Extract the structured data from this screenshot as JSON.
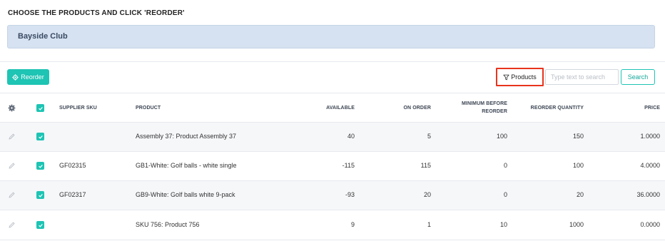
{
  "page": {
    "heading": "CHOOSE THE PRODUCTS AND CLICK 'REORDER'"
  },
  "customer": {
    "name": "Bayside Club"
  },
  "toolbar": {
    "reorder_label": "Reorder",
    "products_filter_label": "Products",
    "search_placeholder": "Type text to search",
    "search_value": "",
    "search_label": "Search"
  },
  "table": {
    "headers": {
      "supplier_sku": "SUPPLIER SKU",
      "product": "PRODUCT",
      "available": "AVAILABLE",
      "on_order": "ON ORDER",
      "minimum_line1": "MINIMUM BEFORE",
      "minimum_line2": "REORDER",
      "reorder_quantity": "REORDER QUANTITY",
      "price": "PRICE"
    },
    "rows": [
      {
        "checked": true,
        "supplier_sku": "",
        "product": "Assembly 37: Product Assembly 37",
        "available": "40",
        "on_order": "5",
        "minimum": "100",
        "reorder_quantity": "150",
        "price": "1.0000"
      },
      {
        "checked": true,
        "supplier_sku": "GF02315",
        "product": "GB1-White: Golf balls - white single",
        "available": "-115",
        "on_order": "115",
        "minimum": "0",
        "reorder_quantity": "100",
        "price": "4.0000"
      },
      {
        "checked": true,
        "supplier_sku": "GF02317",
        "product": "GB9-White: Golf balls white 9-pack",
        "available": "-93",
        "on_order": "20",
        "minimum": "0",
        "reorder_quantity": "20",
        "price": "36.0000"
      },
      {
        "checked": true,
        "supplier_sku": "",
        "product": "SKU 756: Product 756",
        "available": "9",
        "on_order": "1",
        "minimum": "10",
        "reorder_quantity": "1000",
        "price": "0.0000"
      }
    ]
  },
  "icons": {
    "settings": "gear-icon",
    "edit": "pencil-icon",
    "filter": "funnel-icon",
    "checkbox": "check-icon"
  },
  "colors": {
    "accent": "#1ec4b4",
    "highlight_border": "#e8341c",
    "customer_bg": "#d6e2f1"
  }
}
